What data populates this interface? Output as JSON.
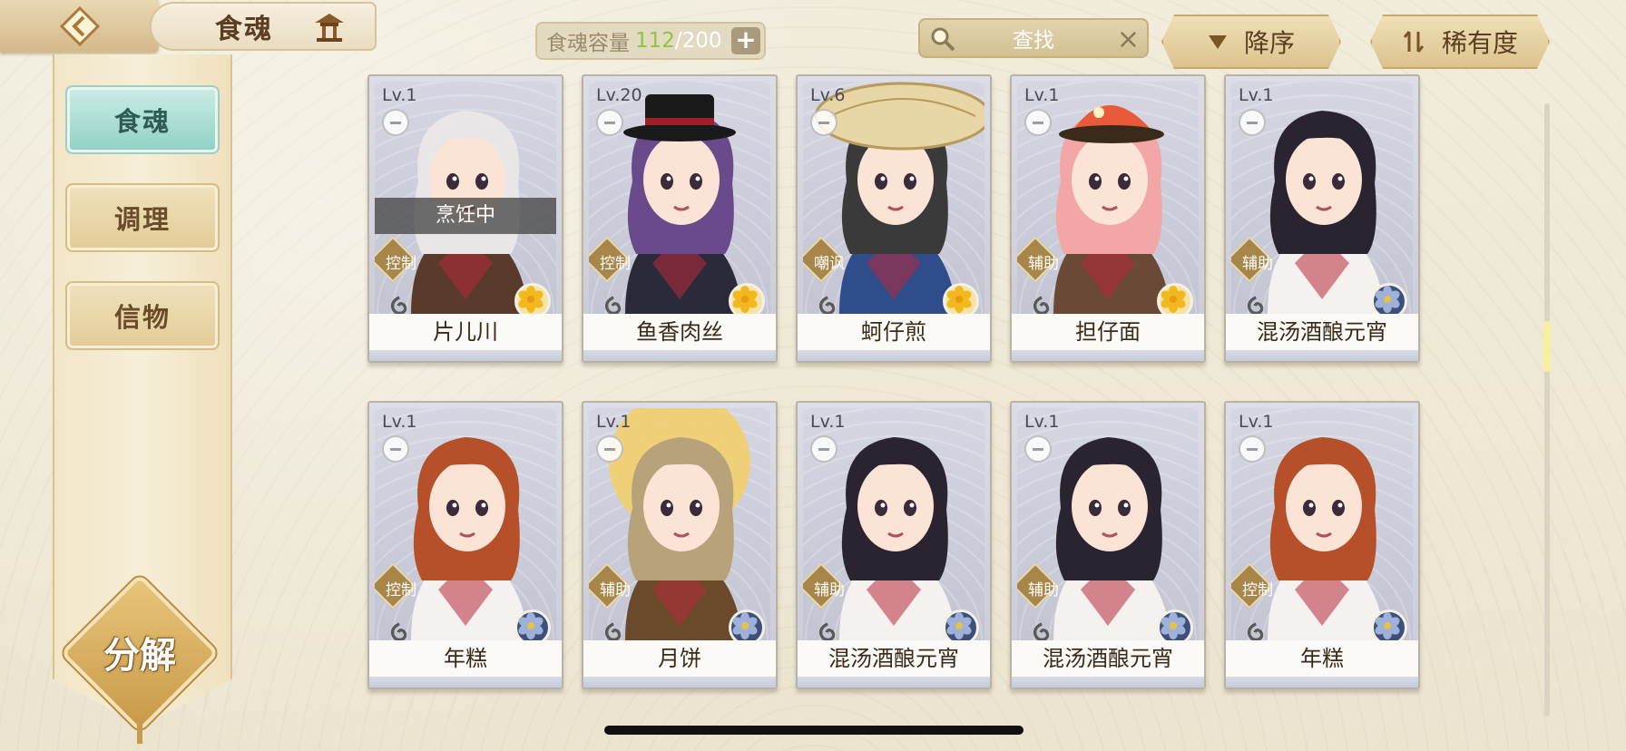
{
  "header": {
    "title": "食魂",
    "capacity_label": "食魂容量",
    "capacity_current": "112",
    "capacity_separator": "/",
    "capacity_max": "200",
    "capacity_add": "+",
    "search_placeholder": "查找",
    "search_clear": "×",
    "sort_order_label": "降序",
    "sort_rarity_label": "稀有度"
  },
  "sidebar": {
    "items": [
      {
        "label": "食魂",
        "active": true
      },
      {
        "label": "调理",
        "active": false
      },
      {
        "label": "信物",
        "active": false
      }
    ],
    "decompose_label": "分解"
  },
  "colors": {
    "accent_teal": "#93d1c6",
    "gold": "#c89a4a",
    "capacity_green": "#8cc63e"
  },
  "cards": [
    {
      "level": "Lv.1",
      "name": "片儿川",
      "role": "控制",
      "rarity": "gold",
      "stars_lit": 1,
      "status": "烹饪中",
      "hair": "#e8e6e6",
      "outfit": "#5a3a2a",
      "hat": "none"
    },
    {
      "level": "Lv.20",
      "name": "鱼香肉丝",
      "role": "控制",
      "rarity": "gold",
      "stars_lit": 2,
      "status": "",
      "hair": "#6a4a8a",
      "outfit": "#2a2a3a",
      "hat": "tophat"
    },
    {
      "level": "Lv.6",
      "name": "蚵仔煎",
      "role": "嘲讽",
      "rarity": "gold",
      "stars_lit": 1,
      "status": "",
      "hair": "#3a3a3a",
      "outfit": "#2f4d8a",
      "hat": "straw"
    },
    {
      "level": "Lv.1",
      "name": "担仔面",
      "role": "辅助",
      "rarity": "gold",
      "stars_lit": 1,
      "status": "",
      "hair": "#f3a6a6",
      "outfit": "#6a4a36",
      "hat": "orange"
    },
    {
      "level": "Lv.1",
      "name": "混汤酒酿元宵",
      "role": "辅助",
      "rarity": "blue",
      "stars_lit": 1,
      "status": "",
      "hair": "#2a2430",
      "outfit": "#f4f1ee",
      "hat": "none"
    },
    {
      "level": "Lv.1",
      "name": "年糕",
      "role": "控制",
      "rarity": "blue",
      "stars_lit": 1,
      "status": "",
      "hair": "#b5502a",
      "outfit": "#f4f1ee",
      "hat": "none"
    },
    {
      "level": "Lv.1",
      "name": "月饼",
      "role": "辅助",
      "rarity": "blue",
      "stars_lit": 1,
      "status": "",
      "hair": "#b8a27a",
      "outfit": "#6a4a2a",
      "hat": "moon"
    },
    {
      "level": "Lv.1",
      "name": "混汤酒酿元宵",
      "role": "辅助",
      "rarity": "blue",
      "stars_lit": 1,
      "status": "",
      "hair": "#2a2430",
      "outfit": "#f4f1ee",
      "hat": "none"
    },
    {
      "level": "Lv.1",
      "name": "混汤酒酿元宵",
      "role": "辅助",
      "rarity": "blue",
      "stars_lit": 1,
      "status": "",
      "hair": "#2a2430",
      "outfit": "#f4f1ee",
      "hat": "none"
    },
    {
      "level": "Lv.1",
      "name": "年糕",
      "role": "控制",
      "rarity": "blue",
      "stars_lit": 1,
      "status": "",
      "hair": "#b5502a",
      "outfit": "#f4f1ee",
      "hat": "none"
    }
  ],
  "scrollbar": {
    "position": 0.35
  }
}
